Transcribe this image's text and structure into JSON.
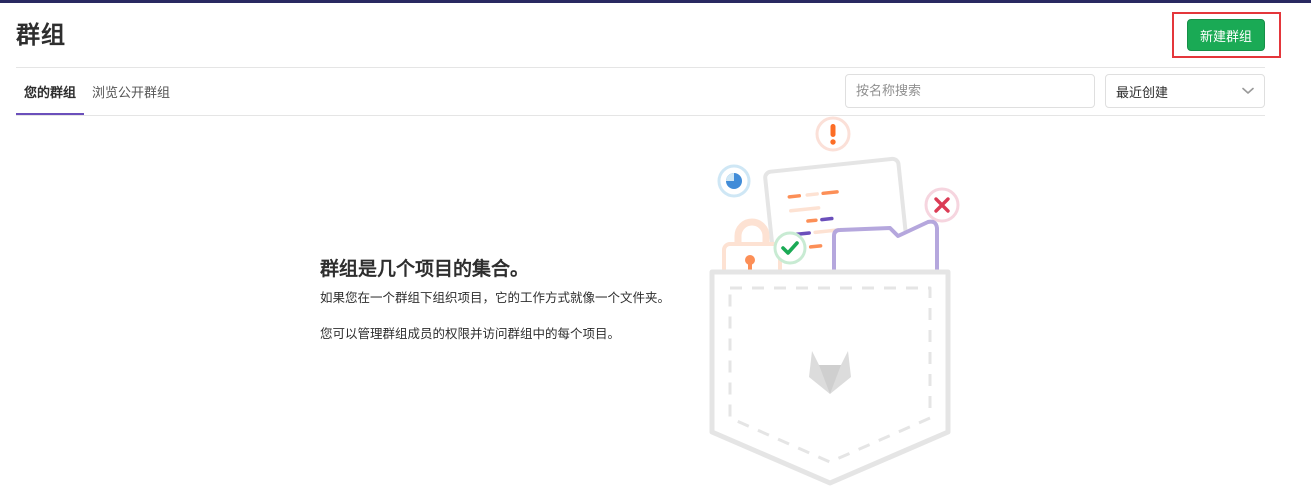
{
  "header": {
    "title": "群组",
    "new_group_label": "新建群组"
  },
  "tabs": [
    {
      "label": "您的群组",
      "active": true
    },
    {
      "label": "浏览公开群组",
      "active": false
    }
  ],
  "search": {
    "placeholder": "按名称搜索",
    "value": ""
  },
  "sort": {
    "selected": "最近创建"
  },
  "empty_state": {
    "title": "群组是几个项目的集合。",
    "description": "如果您在一个群组下组织项目，它的工作方式就像一个文件夹。",
    "description2": "您可以管理群组成员的权限并访问群组中的每个项目。"
  },
  "colors": {
    "primary_green": "#1aaa55",
    "highlight_red": "#e4363b",
    "active_tab": "#6b4fbb",
    "top_bar": "#292961"
  }
}
